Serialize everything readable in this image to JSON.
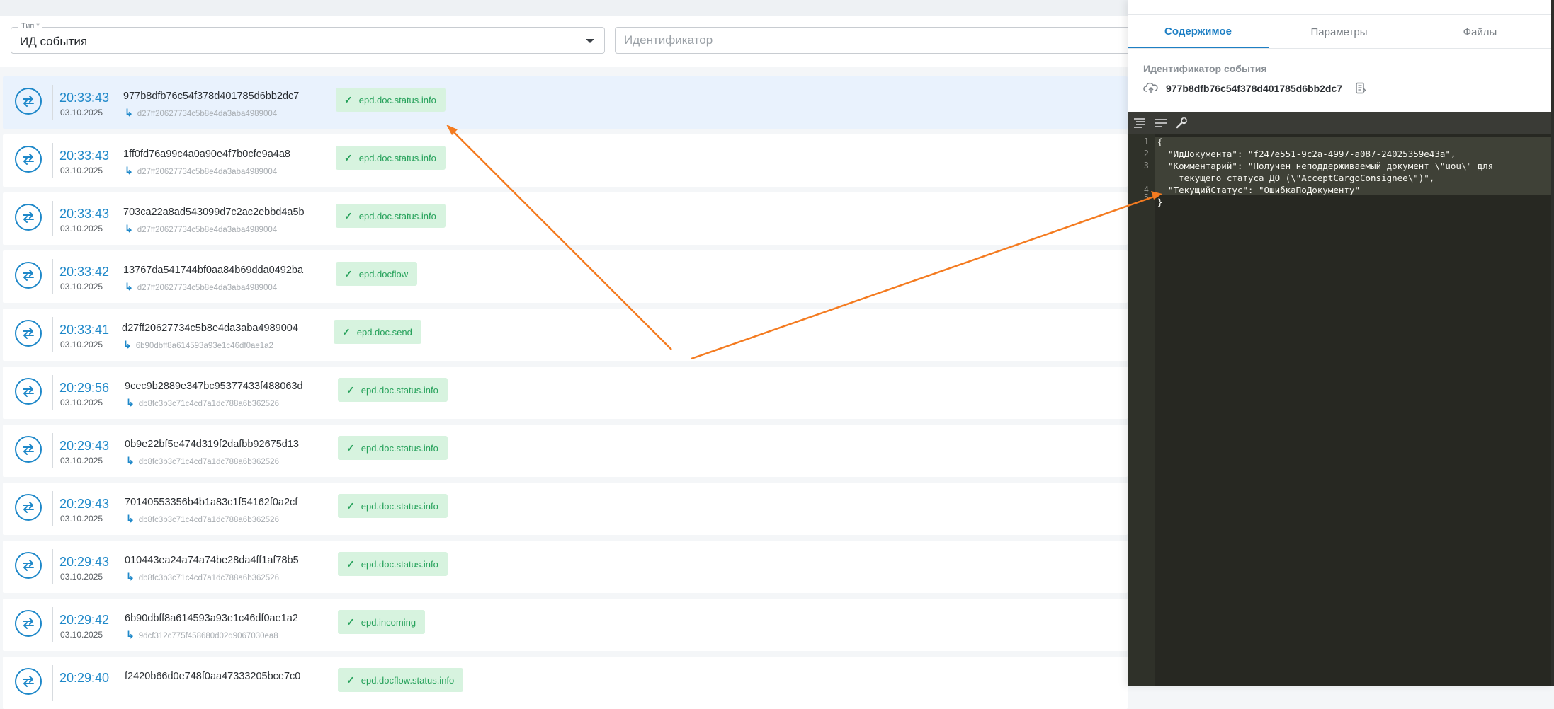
{
  "filters": {
    "type_label": "Тип *",
    "type_value": "ИД события",
    "id_placeholder": "Идентификатор"
  },
  "events": [
    {
      "time": "20:33:43",
      "date": "03.10.2025",
      "id": "977b8dfb76c54f378d401785d6bb2dc7",
      "parent": "d27ff20627734c5b8e4da3aba4989004",
      "tag": "epd.doc.status.info",
      "selected": true
    },
    {
      "time": "20:33:43",
      "date": "03.10.2025",
      "id": "1ff0fd76a99c4a0a90e4f7b0cfe9a4a8",
      "parent": "d27ff20627734c5b8e4da3aba4989004",
      "tag": "epd.doc.status.info"
    },
    {
      "time": "20:33:43",
      "date": "03.10.2025",
      "id": "703ca22a8ad543099d7c2ac2ebbd4a5b",
      "parent": "d27ff20627734c5b8e4da3aba4989004",
      "tag": "epd.doc.status.info"
    },
    {
      "time": "20:33:42",
      "date": "03.10.2025",
      "id": "13767da541744bf0aa84b69dda0492ba",
      "parent": "d27ff20627734c5b8e4da3aba4989004",
      "tag": "epd.docflow"
    },
    {
      "time": "20:33:41",
      "date": "03.10.2025",
      "id": "d27ff20627734c5b8e4da3aba4989004",
      "parent": "6b90dbff8a614593a93e1c46df0ae1a2",
      "tag": "epd.doc.send"
    },
    {
      "time": "20:29:56",
      "date": "03.10.2025",
      "id": "9cec9b2889e347bc95377433f488063d",
      "parent": "db8fc3b3c71c4cd7a1dc788a6b362526",
      "tag": "epd.doc.status.info"
    },
    {
      "time": "20:29:43",
      "date": "03.10.2025",
      "id": "0b9e22bf5e474d319f2dafbb92675d13",
      "parent": "db8fc3b3c71c4cd7a1dc788a6b362526",
      "tag": "epd.doc.status.info"
    },
    {
      "time": "20:29:43",
      "date": "03.10.2025",
      "id": "70140553356b4b1a83c1f54162f0a2cf",
      "parent": "db8fc3b3c71c4cd7a1dc788a6b362526",
      "tag": "epd.doc.status.info"
    },
    {
      "time": "20:29:43",
      "date": "03.10.2025",
      "id": "010443ea24a74a74be28da4ff1af78b5",
      "parent": "db8fc3b3c71c4cd7a1dc788a6b362526",
      "tag": "epd.doc.status.info"
    },
    {
      "time": "20:29:42",
      "date": "03.10.2025",
      "id": "6b90dbff8a614593a93e1c46df0ae1a2",
      "parent": "9dcf312c775f458680d02d9067030ea8",
      "tag": "epd.incoming"
    },
    {
      "time": "20:29:40",
      "date": "",
      "id": "f2420b66d0e748f0aa47333205bce7c0",
      "parent": "",
      "tag": "epd.docflow.status.info"
    }
  ],
  "panel": {
    "tabs": [
      "Содержимое",
      "Параметры",
      "Файлы"
    ],
    "active_tab": "Содержимое",
    "id_label": "Идентификатор события",
    "id_value": "977b8dfb76c54f378d401785d6bb2dc7",
    "editor": {
      "line_numbers": [
        "1",
        "2",
        "3",
        "4",
        "5"
      ],
      "lines": [
        "{",
        "  \"ИдДокумента\": \"f247e551-9c2a-4997-a087-24025359e43a\",",
        "  \"Комментарий\": \"Получен неподдерживаемый документ \\\"uou\\\" для",
        "    текущего статуса ДО (\\\"AcceptCargoConsignee\\\")\",",
        "  \"ТекущийСтатус\": \"ОшибкаПоДокументу\"",
        "}"
      ]
    }
  },
  "colors": {
    "accent": "#1e88c9",
    "tag_bg": "#d7f3df",
    "tag_text": "#25a15a",
    "editor_bg": "#272822",
    "annotation": "#f47b20"
  }
}
